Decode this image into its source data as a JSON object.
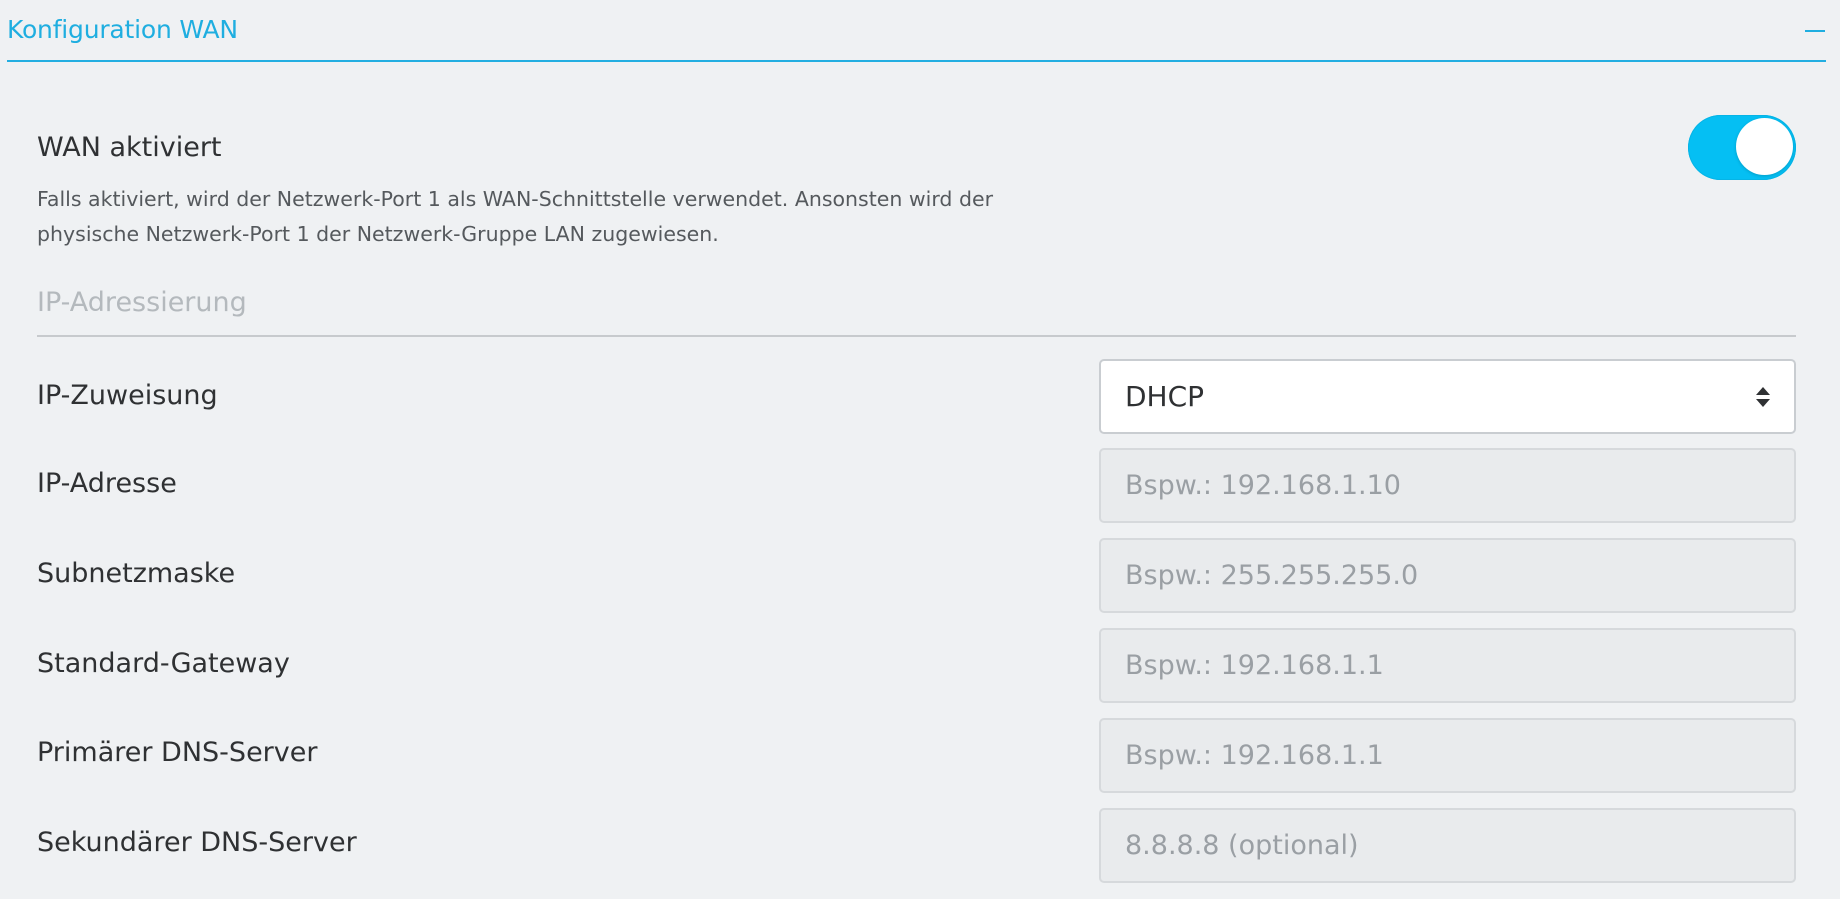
{
  "panel": {
    "title": "Konfiguration WAN",
    "collapse_icon": "minus-icon"
  },
  "wan": {
    "title": "WAN aktiviert",
    "description": "Falls aktiviert, wird der Netzwerk-Port 1 als WAN-Schnittstelle verwendet. Ansonsten wird der physische Netzwerk-Port 1 der Netzwerk-Gruppe LAN zugewiesen.",
    "enabled": true,
    "accent_color": "#05bff3"
  },
  "ip_section": {
    "heading": "IP-Adressierung"
  },
  "fields": {
    "ip_assignment": {
      "label": "IP-Zuweisung",
      "value": "DHCP",
      "icon": "sort-arrows-icon"
    },
    "ip_address": {
      "label": "IP-Adresse",
      "placeholder": "Bspw.: 192.168.1.10"
    },
    "subnet_mask": {
      "label": "Subnetzmaske",
      "placeholder": "Bspw.: 255.255.255.0"
    },
    "default_gateway": {
      "label": "Standard-Gateway",
      "placeholder": "Bspw.: 192.168.1.1"
    },
    "primary_dns": {
      "label": "Primärer DNS-Server",
      "placeholder": "Bspw.: 192.168.1.1"
    },
    "secondary_dns": {
      "label": "Sekundärer DNS-Server",
      "placeholder": "8.8.8.8 (optional)"
    }
  }
}
